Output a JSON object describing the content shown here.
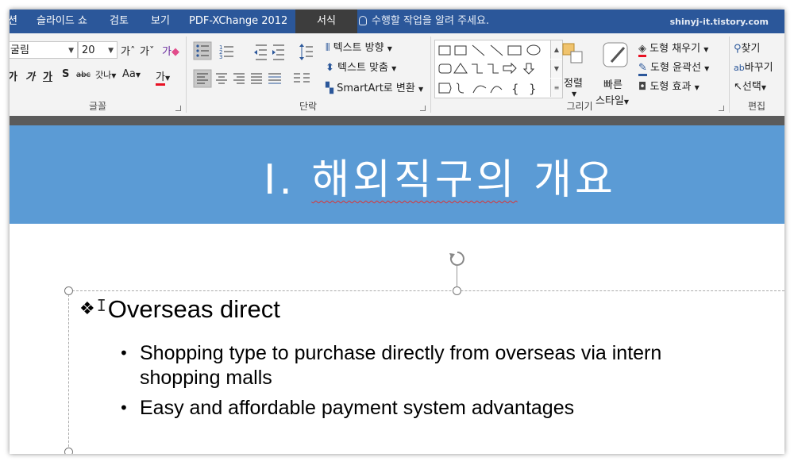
{
  "tabs": [
    "션",
    "슬라이드 쇼",
    "검토",
    "보기",
    "PDF-XChange 2012",
    "서식"
  ],
  "tell_me": "수행할 작업을 알려 주세요.",
  "watermark": "shinyj-it.tistory.com",
  "font_group": {
    "label": "글꼴",
    "font_name": "굴림",
    "font_size": "20",
    "grow": "가ˆ",
    "shrink": "가ˇ",
    "clear": "가",
    "bold": "가",
    "italic": "가",
    "underline": "가",
    "shadow": "S",
    "strike": "abc",
    "spacing": "갓나",
    "case": "Aa",
    "color": "가"
  },
  "paragraph_group": {
    "label": "단락",
    "text_direction": "텍스트 방향",
    "align_text": "텍스트 맞춤",
    "smartart": "SmartArt로 변환"
  },
  "drawing_group": {
    "label": "그리기",
    "arrange": "정렬",
    "quick_styles_1": "빠른",
    "quick_styles_2": "스타일",
    "fill": "도형 채우기",
    "outline": "도형 윤곽선",
    "effects": "도형 효과"
  },
  "editing_group": {
    "label": "편집",
    "find": "찾기",
    "replace": "바꾸기",
    "select": "선택"
  },
  "slide": {
    "title_prefix": "Ⅰ. ",
    "title_main": "해외직구의",
    "title_suffix": " 개요",
    "level1": "Overseas direct",
    "bullets": [
      "Shopping type to purchase directly from overseas via intern",
      "shopping malls",
      "Easy and affordable payment system advantages"
    ]
  },
  "colors": {
    "tabbar": "#2b579a",
    "banner": "#5b9bd5",
    "ribbon": "#f3f3f3",
    "accent_red": "#e81123"
  }
}
